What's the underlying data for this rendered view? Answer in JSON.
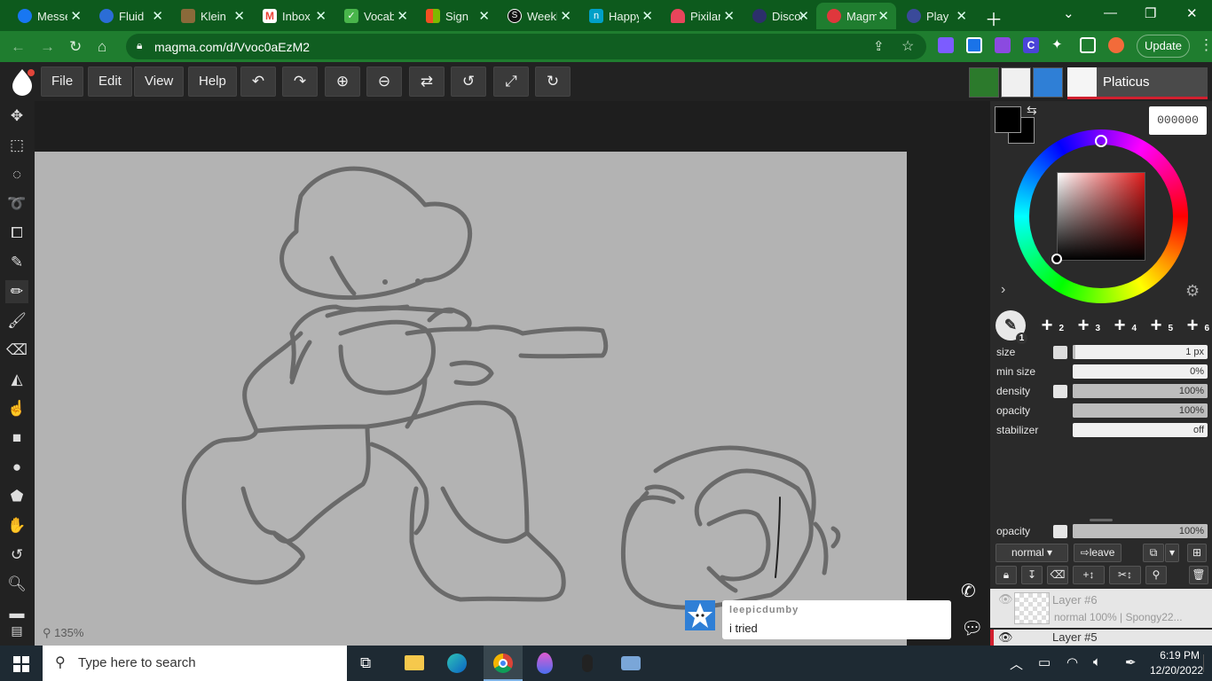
{
  "browser": {
    "tabs": [
      {
        "label": "Messenger",
        "color": "#1877f2"
      },
      {
        "label": "Fluid",
        "color": "#2b6dd6"
      },
      {
        "label": "Klein",
        "color": "#8a6a3a"
      },
      {
        "label": "Inbox",
        "color": "#ea4335"
      },
      {
        "label": "Vocab",
        "color": "#49b54b"
      },
      {
        "label": "Sign",
        "color": "#f25022"
      },
      {
        "label": "Weekly",
        "color": "#111111"
      },
      {
        "label": "Happy",
        "color": "#00a0c8"
      },
      {
        "label": "Pixilart",
        "color": "#e8455b"
      },
      {
        "label": "Discord",
        "color": "#2c2f6b"
      },
      {
        "label": "Magma",
        "color": "#e0373c"
      },
      {
        "label": "Play",
        "color": "#3a4a9a"
      }
    ],
    "active_tab": 10,
    "url": "magma.com/d/Vvoc0aEzM2",
    "update_label": "Update"
  },
  "app": {
    "menus": [
      "File",
      "Edit",
      "View",
      "Help"
    ],
    "toolbar_icons": [
      "undo-icon",
      "redo-icon",
      "zoom-in-icon",
      "zoom-out-icon",
      "flip-icon",
      "rotate-reset-icon",
      "fullscreen-icon",
      "refresh-icon"
    ],
    "username": "Platicus",
    "zoom": "135%"
  },
  "tools": [
    "move-icon",
    "rect-select-icon",
    "ellipse-select-icon",
    "lasso-icon",
    "transform-icon",
    "eyedropper-icon",
    "pencil-icon",
    "brush-icon",
    "eraser-icon",
    "paint-bucket-icon",
    "smudge-icon",
    "rectangle-icon",
    "ellipse-icon",
    "shape-icon",
    "hand-icon",
    "rotate-view-icon",
    "zoom-icon"
  ],
  "active_tool": 6,
  "chat": {
    "user": "leepicdumby",
    "message": "i tried"
  },
  "panel": {
    "color_hex": "000000",
    "brush_slots": [
      "1",
      "2",
      "3",
      "4",
      "5",
      "6"
    ],
    "brush": {
      "size_label": "size",
      "size_value": "1 px",
      "min_size_label": "min size",
      "min_size_value": "0%",
      "density_label": "density",
      "density_value": "100%",
      "opacity_label": "opacity",
      "opacity_value": "100%",
      "stabilizer_label": "stabilizer",
      "stabilizer_value": "off"
    },
    "layer_opacity_label": "opacity",
    "layer_opacity_value": "100%",
    "blend_mode": "normal",
    "leave_label": "leave",
    "layers": [
      {
        "name": "Layer #6",
        "info": "normal 100% | Spongy22..."
      },
      {
        "name": "Layer #5",
        "info": ""
      }
    ]
  },
  "taskbar": {
    "search_placeholder": "Type here to search",
    "time": "6:19 PM",
    "date": "12/20/2022"
  }
}
